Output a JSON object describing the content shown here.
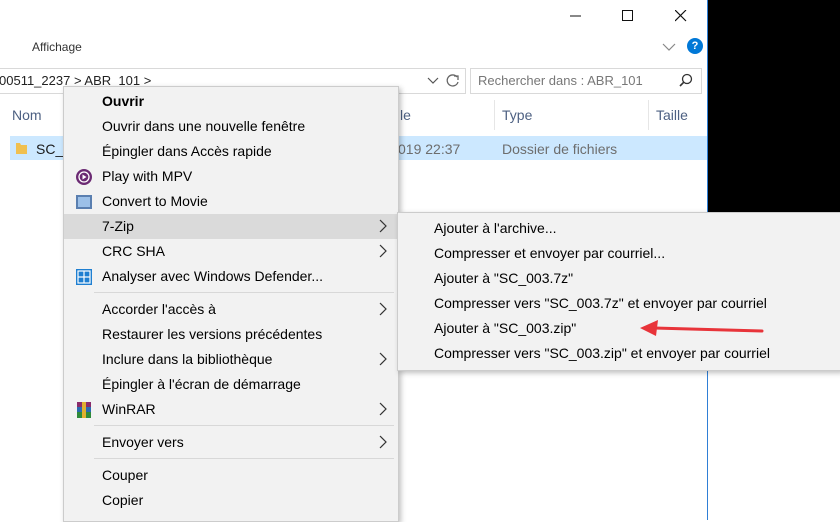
{
  "window": {
    "ribbon_tab": "Affichage",
    "address_path": "00511_2237 > ABR_101 >",
    "search_placeholder": "Rechercher dans : ABR_101"
  },
  "columns": {
    "name": "Nom",
    "date_partial": "le",
    "type": "Type",
    "size": "Taille"
  },
  "file_row": {
    "name_partial": "SC_0",
    "date_partial": "019 22:37",
    "type": "Dossier de fichiers"
  },
  "context_menu": {
    "items": [
      {
        "label": "Ouvrir"
      },
      {
        "label": "Ouvrir dans une nouvelle fenêtre"
      },
      {
        "label": "Épingler dans Accès rapide"
      },
      {
        "label": "Play with MPV"
      },
      {
        "label": "Convert to Movie"
      },
      {
        "label": "7-Zip"
      },
      {
        "label": "CRC SHA"
      },
      {
        "label": "Analyser avec Windows Defender..."
      },
      {
        "label": "Accorder l'accès à"
      },
      {
        "label": "Restaurer les versions précédentes"
      },
      {
        "label": "Inclure dans la bibliothèque"
      },
      {
        "label": "Épingler à l'écran de démarrage"
      },
      {
        "label": "WinRAR"
      },
      {
        "label": "Envoyer vers"
      },
      {
        "label": "Couper"
      },
      {
        "label": "Copier"
      }
    ]
  },
  "submenu_7zip": {
    "items": [
      {
        "label": "Ajouter à l'archive..."
      },
      {
        "label": "Compresser et envoyer par courriel..."
      },
      {
        "label": "Ajouter à \"SC_003.7z\""
      },
      {
        "label": "Compresser vers \"SC_003.7z\" et envoyer par courriel"
      },
      {
        "label": "Ajouter à \"SC_003.zip\""
      },
      {
        "label": "Compresser vers \"SC_003.zip\" et envoyer par courriel"
      }
    ]
  },
  "colors": {
    "selection": "#cce8ff",
    "arrow": "#e8343a",
    "accent": "#0078d7"
  }
}
